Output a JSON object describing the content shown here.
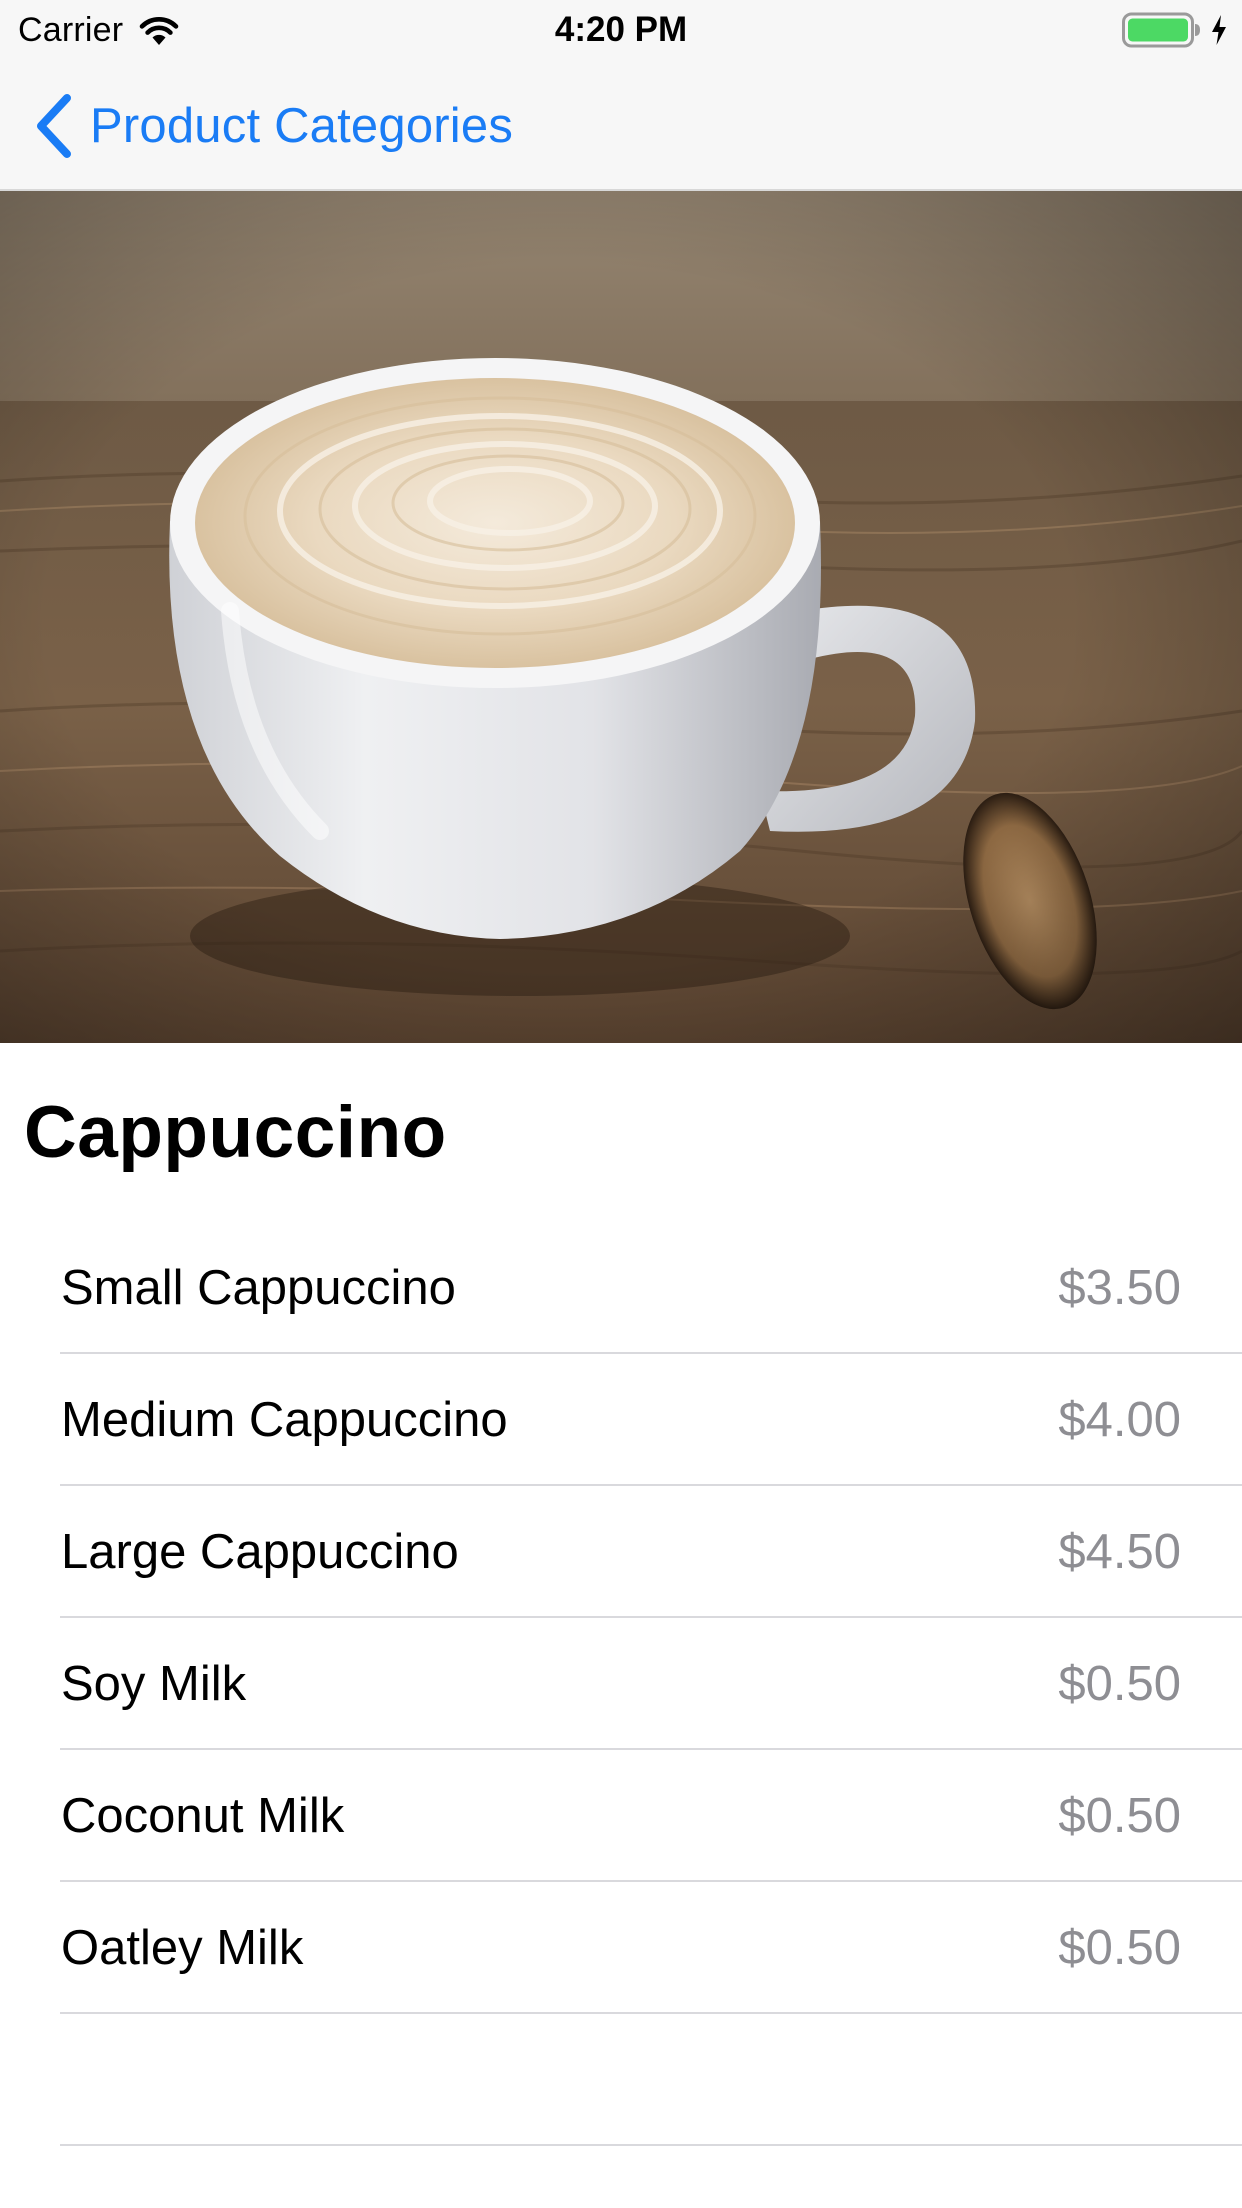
{
  "status_bar": {
    "carrier": "Carrier",
    "time": "4:20 PM",
    "icons": [
      "wifi-icon",
      "battery-icon",
      "charging-bolt-icon"
    ],
    "battery_color": "#4cd964"
  },
  "nav": {
    "back_label": "Product Categories",
    "back_icon": "chevron-left-icon",
    "accent_color": "#1a7cf5"
  },
  "hero": {
    "image": "cappuccino-photo"
  },
  "product": {
    "title": "Cappuccino",
    "items": [
      {
        "name": "Small Cappuccino",
        "price": "$3.50"
      },
      {
        "name": "Medium Cappuccino",
        "price": "$4.00"
      },
      {
        "name": "Large Cappuccino",
        "price": "$4.50"
      },
      {
        "name": "Soy Milk",
        "price": "$0.50"
      },
      {
        "name": "Coconut Milk",
        "price": "$0.50"
      },
      {
        "name": "Oatley Milk",
        "price": "$0.50"
      }
    ]
  }
}
